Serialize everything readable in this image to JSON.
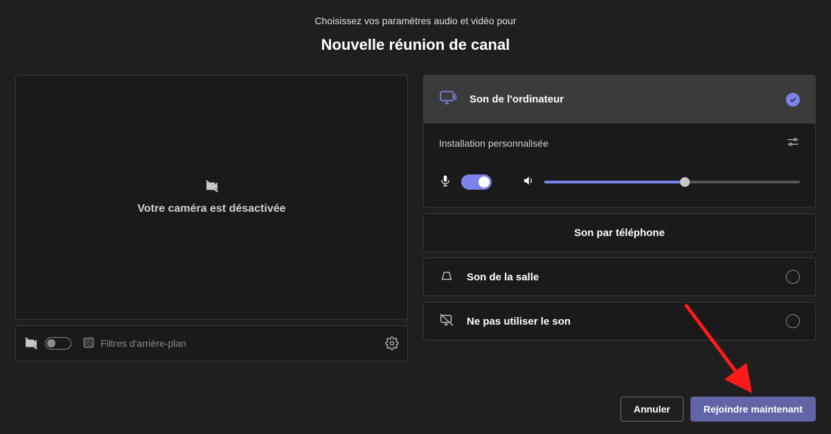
{
  "header": {
    "subtitle": "Choisissez vos paramètres audio et vidéo pour",
    "title": "Nouvelle réunion de canal"
  },
  "video": {
    "camera_off_message": "Votre caméra est désactivée",
    "background_filters_label": "Filtres d'arrière-plan"
  },
  "audio": {
    "computer": {
      "label": "Son de l'ordinateur",
      "selected": true
    },
    "setup_label": "Installation personnalisée",
    "mic_on": true,
    "volume_percent": 55,
    "phone": {
      "label": "Son par téléphone",
      "enabled": false
    },
    "room": {
      "label": "Son de la salle"
    },
    "none": {
      "label": "Ne pas utiliser le son"
    }
  },
  "footer": {
    "cancel": "Annuler",
    "join": "Rejoindre maintenant"
  },
  "colors": {
    "accent": "#7b83eb",
    "primary_button": "#6264a7"
  }
}
